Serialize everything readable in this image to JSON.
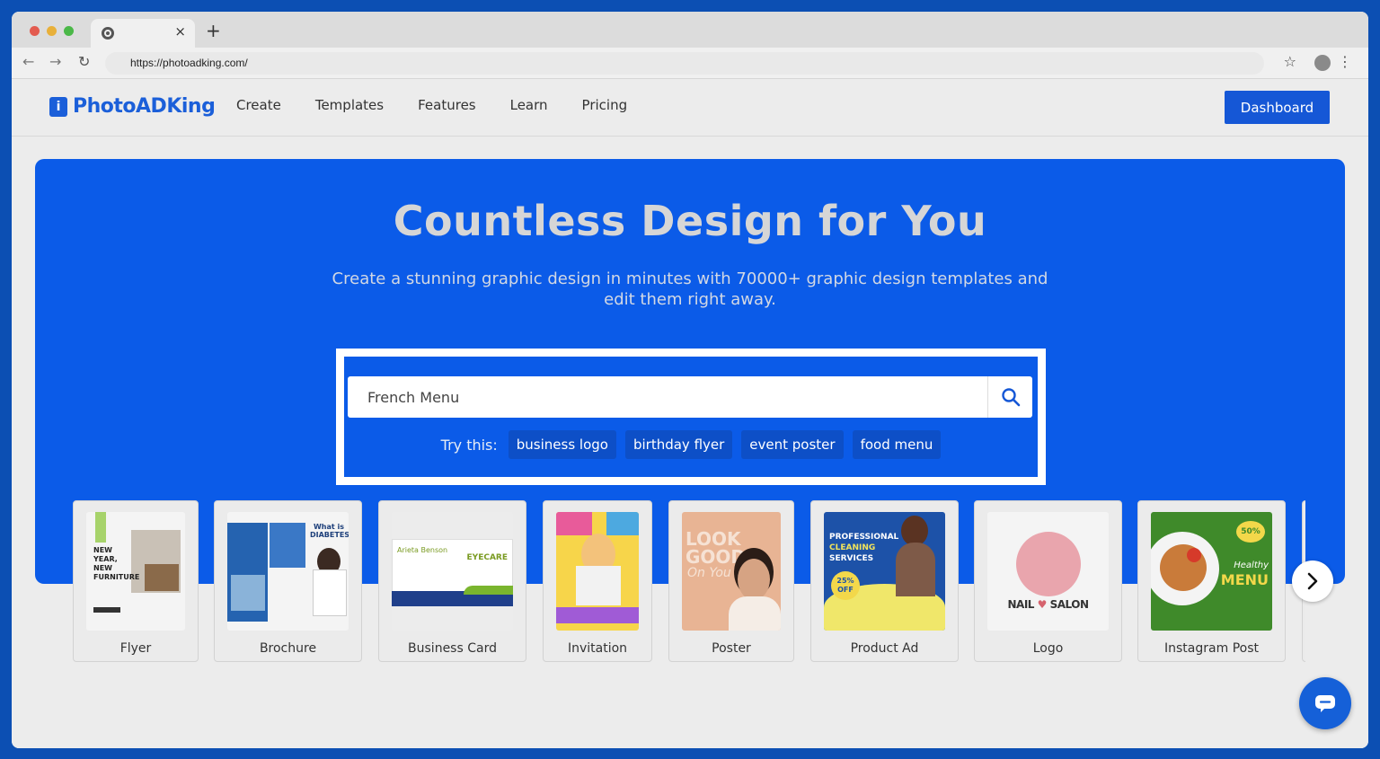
{
  "browser": {
    "url": "https://photoadking.com/",
    "tab_close": "×",
    "new_tab": "+"
  },
  "site": {
    "logo_mark": "i",
    "logo": "PhotoADKing",
    "nav": [
      "Create",
      "Templates",
      "Features",
      "Learn",
      "Pricing"
    ],
    "dashboard": "Dashboard"
  },
  "hero": {
    "title": "Countless Design for You",
    "subtitle": "Create a stunning graphic design in minutes with 70000+ graphic design templates and edit them right away.",
    "search_value": "French Menu",
    "try_label": "Try this:",
    "chips": [
      "business logo",
      "birthday flyer",
      "event poster",
      "food menu"
    ]
  },
  "categories": [
    {
      "label": "Flyer",
      "thumb": [
        "NEW",
        "YEAR,",
        "NEW",
        "FURNITURE"
      ]
    },
    {
      "label": "Brochure",
      "thumb": [
        "What is",
        "DIABETES?"
      ]
    },
    {
      "label": "Business Card",
      "thumb": [
        "Arieta Benson",
        "EYECARE"
      ]
    },
    {
      "label": "Invitation",
      "thumb": []
    },
    {
      "label": "Poster",
      "thumb": [
        "LOOK",
        "GOOD",
        "On You"
      ]
    },
    {
      "label": "Product Ad",
      "thumb": [
        "PROFESSIONAL",
        "CLEANING",
        "SERVICES",
        "25%",
        "OFF"
      ]
    },
    {
      "label": "Logo",
      "thumb": [
        "NAIL",
        "SALON"
      ]
    },
    {
      "label": "Instagram Post",
      "thumb": [
        "50%",
        "Healthy",
        "MENU"
      ]
    }
  ],
  "colors": {
    "frame_bg": "#0c4fb3",
    "hero_bg": "#0b5be8",
    "brand_blue": "#1557d6",
    "chip_bg": "#0d4fc7"
  }
}
